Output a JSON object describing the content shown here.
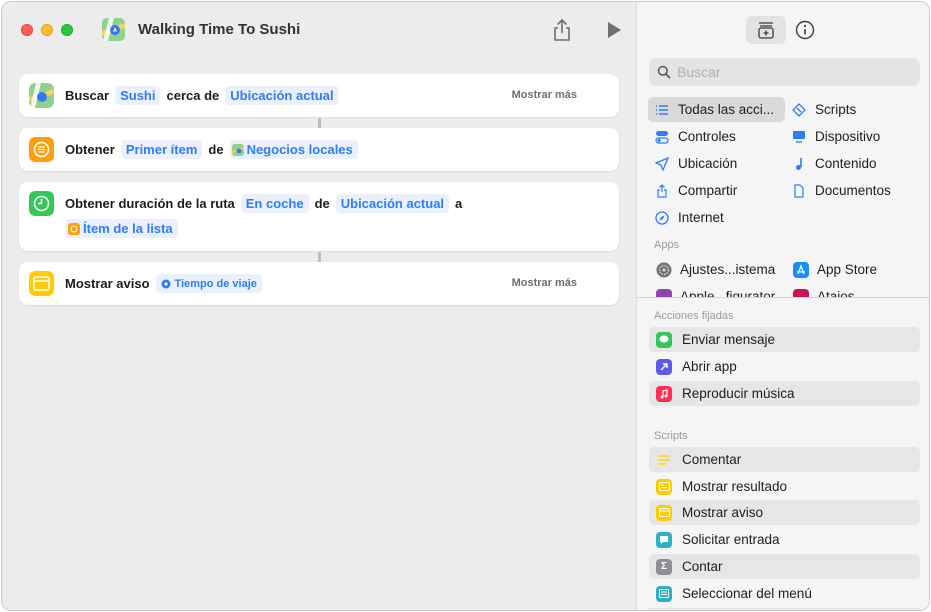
{
  "window": {
    "title": "Walking Time To Sushi"
  },
  "workflow": {
    "actions": [
      {
        "verb": "Buscar",
        "token1": "Sushi",
        "mid": "cerca de",
        "token2": "Ubicación actual",
        "more": "Mostrar más"
      },
      {
        "verb": "Obtener",
        "token1": "Primer ítem",
        "mid": "de",
        "token2": "Negocios locales"
      },
      {
        "verb": "Obtener duración de la ruta",
        "token1": "En coche",
        "mid": "de",
        "token2": "Ubicación actual",
        "mid2": "a",
        "token3": "Ítem de la lista"
      },
      {
        "verb": "Mostrar aviso",
        "token1": "Tiempo de viaje",
        "more": "Mostrar más"
      }
    ]
  },
  "library": {
    "search_placeholder": "Buscar",
    "categories": [
      {
        "label": "Todas las acci...",
        "icon": "list-icon",
        "selected": true
      },
      {
        "label": "Scripts",
        "icon": "scripts-icon"
      },
      {
        "label": "Controles",
        "icon": "toggle-icon"
      },
      {
        "label": "Dispositivo",
        "icon": "display-icon"
      },
      {
        "label": "Ubicación",
        "icon": "location-arrow-icon"
      },
      {
        "label": "Contenido",
        "icon": "music-note-icon"
      },
      {
        "label": "Compartir",
        "icon": "share-icon"
      },
      {
        "label": "Documentos",
        "icon": "document-icon"
      },
      {
        "label": "Internet",
        "icon": "compass-icon"
      }
    ],
    "apps_heading": "Apps",
    "apps": [
      {
        "label": "Ajustes...istema",
        "icon": "settings-icon"
      },
      {
        "label": "App Store",
        "icon": "app-store-icon"
      },
      {
        "label": "Apple...figurator",
        "icon": "configurator-icon"
      },
      {
        "label": "Atajos",
        "icon": "shortcuts-icon"
      }
    ],
    "pinned_heading": "Acciones fijadas",
    "pinned": [
      {
        "label": "Enviar mensaje",
        "icon": "message-icon",
        "color": "#34c759"
      },
      {
        "label": "Abrir app",
        "icon": "open-app-icon",
        "color": "#5e5ce6"
      },
      {
        "label": "Reproducir música",
        "icon": "music-icon",
        "color": "#ff2d55"
      }
    ],
    "scripts_heading": "Scripts",
    "scripts": [
      {
        "label": "Comentar",
        "icon": "comment-icon",
        "color": "#ffd60a"
      },
      {
        "label": "Mostrar resultado",
        "icon": "show-result-icon",
        "color": "#ffcc00"
      },
      {
        "label": "Mostrar aviso",
        "icon": "alert-icon",
        "color": "#ffcc00"
      },
      {
        "label": "Solicitar entrada",
        "icon": "ask-input-icon",
        "color": "#30b0c7"
      },
      {
        "label": "Contar",
        "icon": "sigma-icon",
        "color": "#8e8e93"
      },
      {
        "label": "Seleccionar del menú",
        "icon": "menu-icon",
        "color": "#30b0c7"
      }
    ]
  }
}
